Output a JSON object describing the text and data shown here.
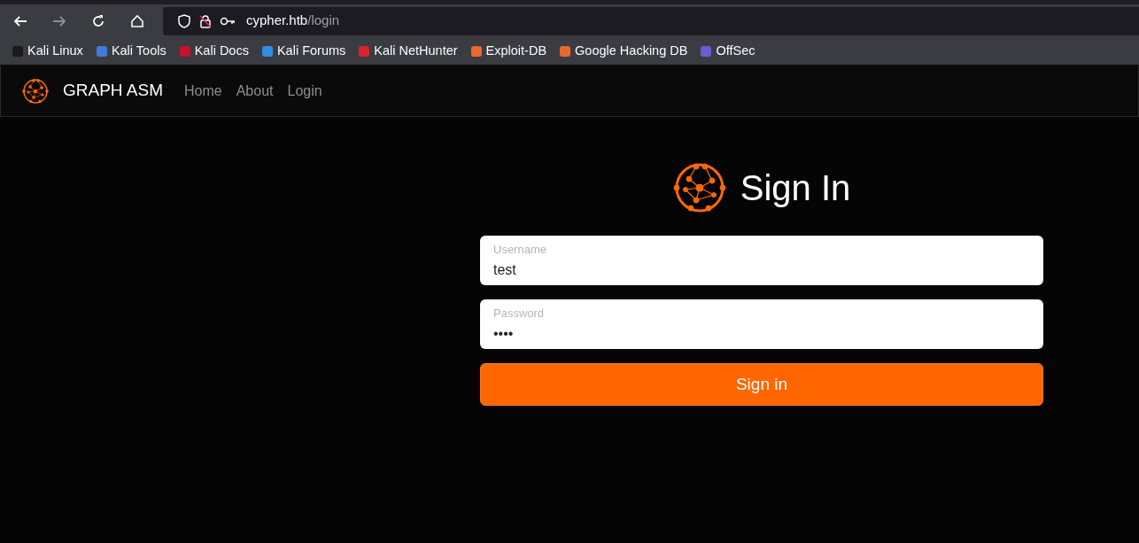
{
  "browser": {
    "url_host": "cypher.htb",
    "url_path": "/login",
    "bookmarks": [
      {
        "label": "Kali Linux",
        "color": "#1a1a1a"
      },
      {
        "label": "Kali Tools",
        "color": "#3b7dd8"
      },
      {
        "label": "Kali Docs",
        "color": "#c8102e"
      },
      {
        "label": "Kali Forums",
        "color": "#2f8ee5"
      },
      {
        "label": "Kali NetHunter",
        "color": "#d9242b"
      },
      {
        "label": "Exploit-DB",
        "color": "#e8692c"
      },
      {
        "label": "Google Hacking DB",
        "color": "#e8692c"
      },
      {
        "label": "OffSec",
        "color": "#6b5bd6"
      }
    ]
  },
  "navbar": {
    "brand": "GRAPH ASM",
    "links": [
      "Home",
      "About",
      "Login"
    ]
  },
  "login": {
    "title": "Sign In",
    "fields": [
      {
        "label": "Username",
        "value": "test"
      },
      {
        "label": "Password",
        "value": "••••"
      }
    ],
    "button": "Sign in"
  }
}
